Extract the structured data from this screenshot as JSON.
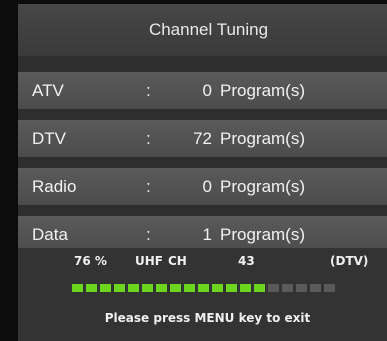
{
  "title": "Channel Tuning",
  "rows": [
    {
      "label": "ATV",
      "colon": ":",
      "count": "0",
      "unit": "Program(s)"
    },
    {
      "label": "DTV",
      "colon": ":",
      "count": "72",
      "unit": "Program(s)"
    },
    {
      "label": "Radio",
      "colon": ":",
      "count": "0",
      "unit": "Program(s)"
    },
    {
      "label": "Data",
      "colon": ":",
      "count": "1",
      "unit": "Program(s)"
    }
  ],
  "status": {
    "percent": "76 %",
    "band": "UHF",
    "channel_label": "CH",
    "channel_number": "43",
    "mode": "(DTV)"
  },
  "progress": {
    "fraction": 0.76,
    "filled_segments": 14,
    "total_segments": 19
  },
  "exit_message": "Please press MENU key to exit",
  "colors": {
    "progress_on": "#6ed51e",
    "progress_off": "#5a5a5a"
  }
}
